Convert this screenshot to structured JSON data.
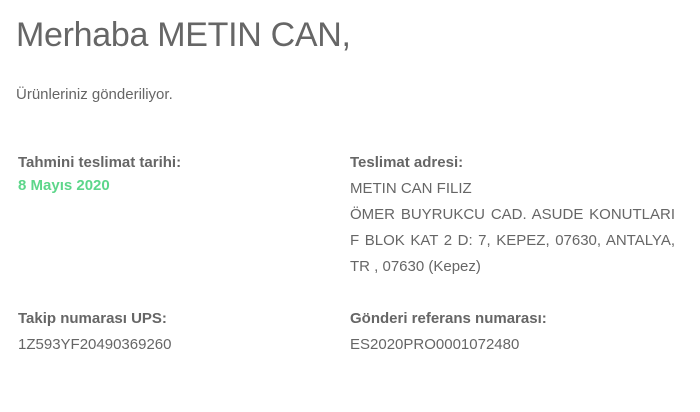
{
  "greeting": "Merhaba METIN CAN,",
  "status_message": "Ürünleriniz gönderiliyor.",
  "delivery_date": {
    "label": "Tahmini teslimat tarihi:",
    "value": "8 Mayıs 2020",
    "value_color": "#5dd68a"
  },
  "delivery_address": {
    "label": "Teslimat adresi:",
    "name": "METIN CAN FILIZ",
    "address": "ÖMER BUYRUKCU CAD. ASUDE KONUTLARI F BLOK KAT 2 D: 7, KEPEZ, 07630, ANTALYA, TR , 07630 (Kepez)"
  },
  "tracking": {
    "label": "Takip numarası UPS:",
    "value": "1Z593YF20490369260"
  },
  "reference": {
    "label": "Gönderi referans numarası:",
    "value": "ES2020PRO0001072480"
  }
}
